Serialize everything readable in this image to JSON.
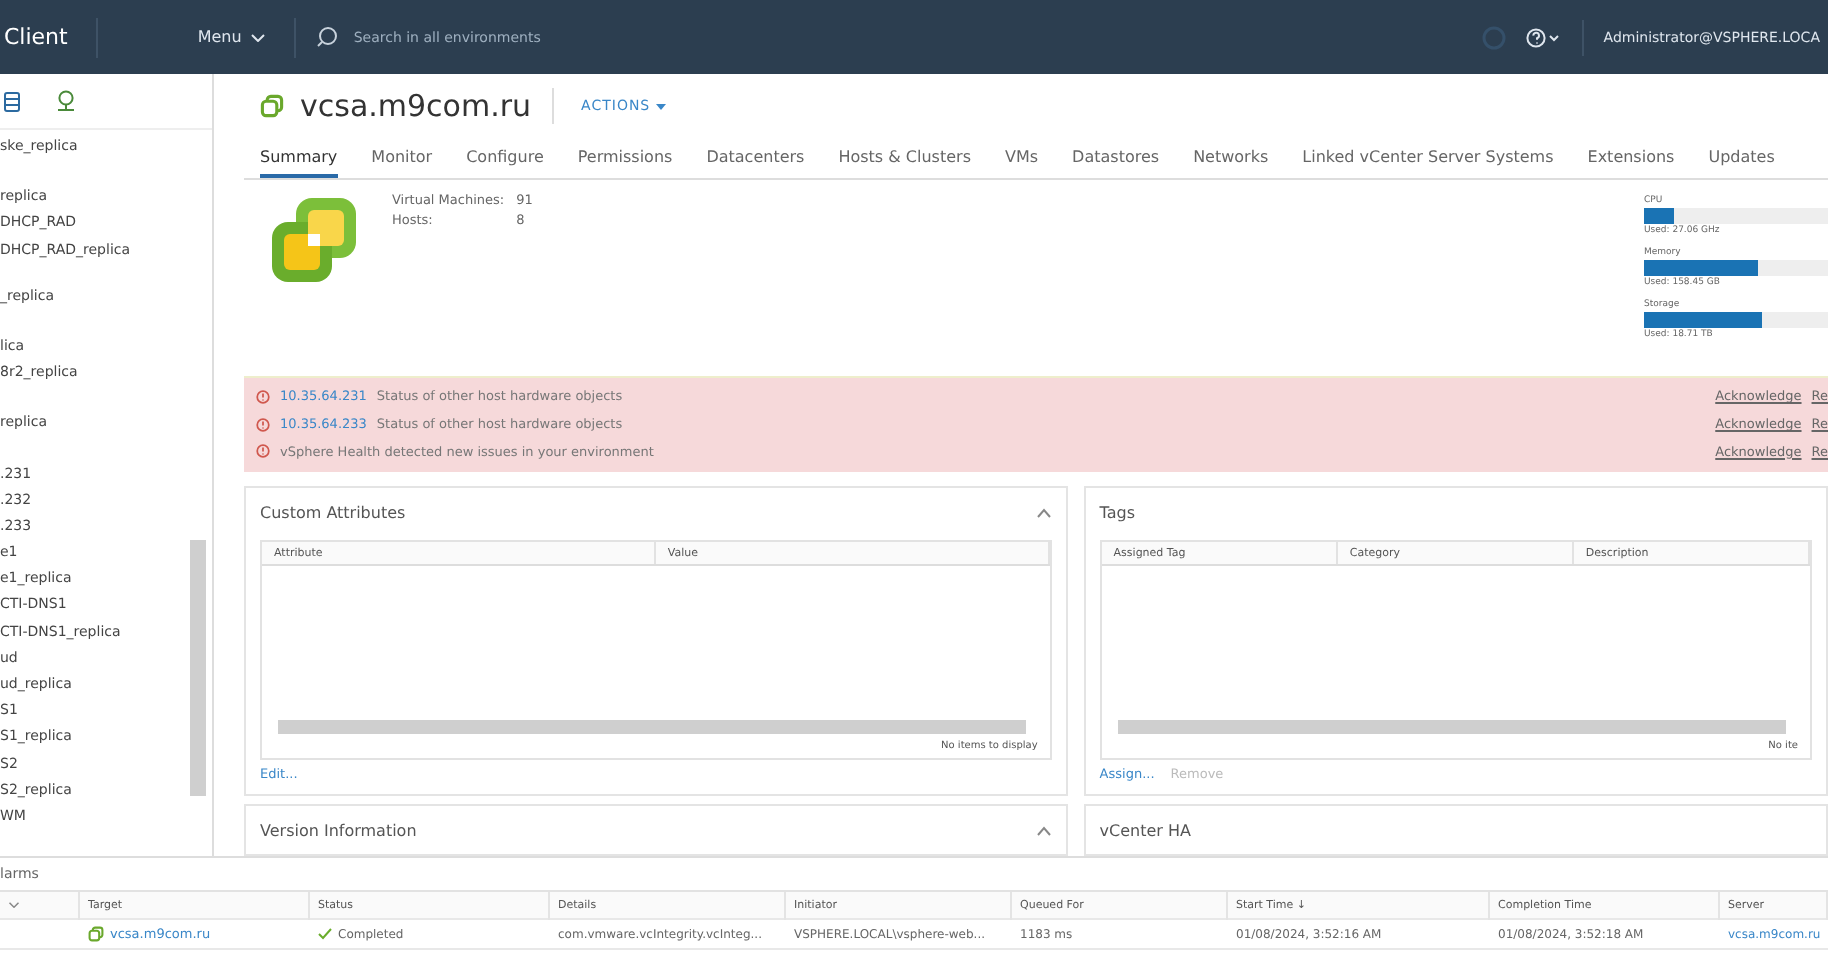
{
  "header": {
    "app_title": "Client",
    "menu": "Menu",
    "search": {
      "placeholder": "Search in all environments"
    },
    "user": "Administrator@VSPHERE.LOCA"
  },
  "sidebar": {
    "items": [
      "ske_replica",
      "replica",
      "DHCP_RAD",
      "DHCP_RAD_replica",
      "_replica",
      "lica",
      "8r2_replica",
      "replica",
      ".231",
      ".232",
      ".233",
      "e1",
      "e1_replica",
      "CTI-DNS1",
      "CTI-DNS1_replica",
      "ud",
      "ud_replica",
      "S1",
      "S1_replica",
      "S2",
      "S2_replica",
      "WM"
    ]
  },
  "object": {
    "title": "vcsa.m9com.ru",
    "actions": "ACTIONS"
  },
  "tabs": [
    {
      "label": "Summary",
      "selected": true
    },
    {
      "label": "Monitor",
      "selected": false
    },
    {
      "label": "Configure",
      "selected": false
    },
    {
      "label": "Permissions",
      "selected": false
    },
    {
      "label": "Datacenters",
      "selected": false
    },
    {
      "label": "Hosts & Clusters",
      "selected": false
    },
    {
      "label": "VMs",
      "selected": false
    },
    {
      "label": "Datastores",
      "selected": false
    },
    {
      "label": "Networks",
      "selected": false
    },
    {
      "label": "Linked vCenter Server Systems",
      "selected": false
    },
    {
      "label": "Extensions",
      "selected": false
    },
    {
      "label": "Updates",
      "selected": false
    }
  ],
  "summary": {
    "stats": [
      {
        "label": "Virtual Machines:",
        "value": "91"
      },
      {
        "label": "Hosts:",
        "value": "8"
      }
    ],
    "capacity": [
      {
        "name": "CPU",
        "level": 0.16,
        "used": "Used: 27.06 GHz"
      },
      {
        "name": "Memory",
        "level": 0.62,
        "used": "Used: 158.45 GB"
      },
      {
        "name": "Storage",
        "level": 0.64,
        "used": "Used: 18.71 TB"
      }
    ]
  },
  "alerts": [
    {
      "host": "10.35.64.231",
      "message": "Status of other host hardware objects",
      "acknowledge": "Acknowledge",
      "reset": "Re"
    },
    {
      "host": "10.35.64.233",
      "message": "Status of other host hardware objects",
      "acknowledge": "Acknowledge",
      "reset": "Re"
    },
    {
      "message": "vSphere Health detected new issues in your environment",
      "acknowledge": "Acknowledge",
      "reset": "Re"
    }
  ],
  "custom_attributes": {
    "title": "Custom Attributes",
    "columns": [
      "Attribute",
      "Value"
    ],
    "empty": "No items to display",
    "actions": [
      {
        "label": "Edit...",
        "disabled": false
      }
    ]
  },
  "tags": {
    "title": "Tags",
    "columns": [
      "Assigned Tag",
      "Category",
      "Description"
    ],
    "empty": "No ite",
    "actions": [
      {
        "label": "Assign...",
        "disabled": false
      },
      {
        "label": "Remove",
        "disabled": true
      }
    ]
  },
  "version_info": {
    "title": "Version Information"
  },
  "vcenter_ha": {
    "title": "vCenter HA"
  },
  "tasks": {
    "tab": "larms",
    "columns": [
      "Target",
      "Status",
      "Details",
      "Initiator",
      "Queued For",
      "Start Time ↓",
      "Completion Time",
      "Server"
    ],
    "rows": [
      {
        "target": "vcsa.m9com.ru",
        "status": "Completed",
        "details": "com.vmware.vcIntegrity.vcInteg...",
        "initiator": "VSPHERE.LOCAL\\vsphere-web...",
        "queued": "1183 ms",
        "start": "01/08/2024, 3:52:16 AM",
        "completion": "01/08/2024, 3:52:18 AM",
        "server": "vcsa.m9com.ru"
      }
    ]
  }
}
